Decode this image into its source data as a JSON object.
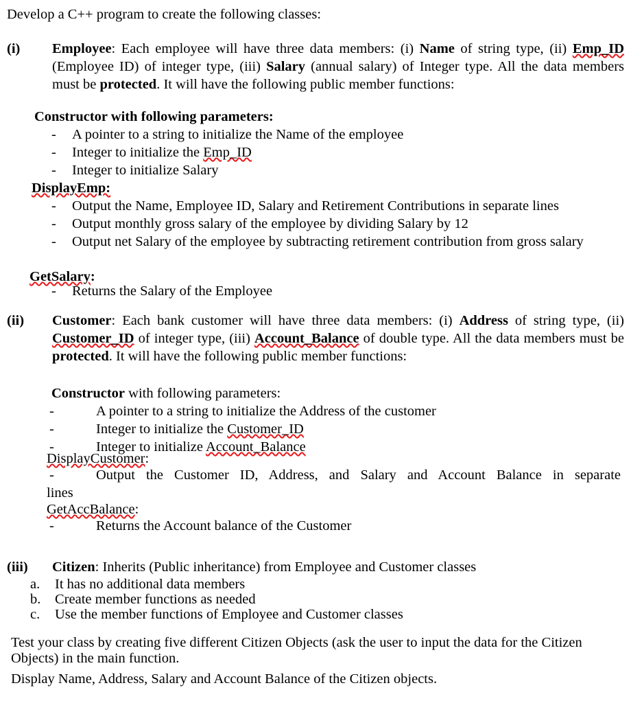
{
  "document": {
    "intro": "Develop a C++ program to create the following classes:",
    "sections": [
      {
        "marker": "(i)",
        "title": "Employee",
        "desc_part1": ": Each employee will have three data members: (i) ",
        "bold1": "Name",
        "desc_part2": " of string type, (ii) ",
        "bold2": "Emp_ID",
        "desc_part3": " (Employee ID) of integer type, (iii) ",
        "bold3": "Salary",
        "desc_part4": " (annual salary) of Integer type. All the data members must be ",
        "bold4": "protected",
        "desc_part5": ".  It will have the following public member functions:"
      },
      {
        "marker": "(ii)",
        "title": "Customer",
        "desc_part1": ": Each bank customer will have three data members: (i) ",
        "bold1": "Address",
        "desc_part2": " of string type, (ii) ",
        "bold2": "Customer_ID",
        "desc_part3": " of integer type, (iii) ",
        "bold3": "Account_Balance",
        "desc_part4": " of double type. All the data members must be ",
        "bold4": "protected",
        "desc_part5": ".  It will have the following public member functions:"
      },
      {
        "marker": "(iii)",
        "title": "Citizen",
        "desc_part1": ": Inherits (Public inheritance) from Employee and Customer classes"
      }
    ],
    "employee_members": {
      "constructor_bold": "Constructor",
      "constructor_rest": " with following parameters:",
      "constructor_items": [
        "A pointer to a string to initialize the Name of the employee",
        "Integer to initialize the Emp_ID",
        "Integer to initialize Salary"
      ],
      "constructor_item2_prefix": "Integer to initialize the ",
      "constructor_item2_sp": "Emp_ID",
      "display_title": "DisplayEmp:",
      "display_items": [
        "Output the Name, Employee ID, Salary and Retirement Contributions in separate lines",
        "Output monthly gross salary of the employee by dividing Salary by 12",
        "Output net Salary of the employee by subtracting retirement contribution from gross salary"
      ],
      "get_title": "GetSalary",
      "get_title_suffix": ":",
      "get_items": [
        "Returns the Salary of the Employee"
      ]
    },
    "customer_members": {
      "constructor_bold": "Constructor",
      "constructor_rest": " with following parameters:",
      "constructor_item1": "A pointer to a string to initialize the Address of the customer",
      "constructor_item2_prefix": "Integer to initialize the ",
      "constructor_item2_sp": "Customer_ID",
      "constructor_item3_prefix": "Integer to initialize ",
      "constructor_item3_sp": "Account_Balance",
      "display_title_sp": "DisplayCustomer",
      "display_title_suffix": ":",
      "display_item1": "Output the Customer ID, Address, and Salary and Account Balance in separate",
      "display_item1_wrap": "lines",
      "get_title_sp": "GetAccBalance",
      "get_title_suffix": ":",
      "get_item1": "Returns the Account balance of the Customer"
    },
    "citizen_items": [
      {
        "label": "a.",
        "text": "It has no additional data members"
      },
      {
        "label": "b.",
        "text": "Create member functions as needed"
      },
      {
        "label": "c.",
        "text": "Use the member functions of Employee and Customer classes"
      }
    ],
    "closing": {
      "paragraph1": "Test your class by creating five different Citizen Objects (ask the user to input the data for the Citizen Objects) in the main function.",
      "paragraph2": "Display Name, Address, Salary and Account Balance of the Citizen objects."
    },
    "colors": {
      "text": "#000000",
      "spellcheck_underline": "#e8191b",
      "page_background": "#ffffff"
    }
  }
}
